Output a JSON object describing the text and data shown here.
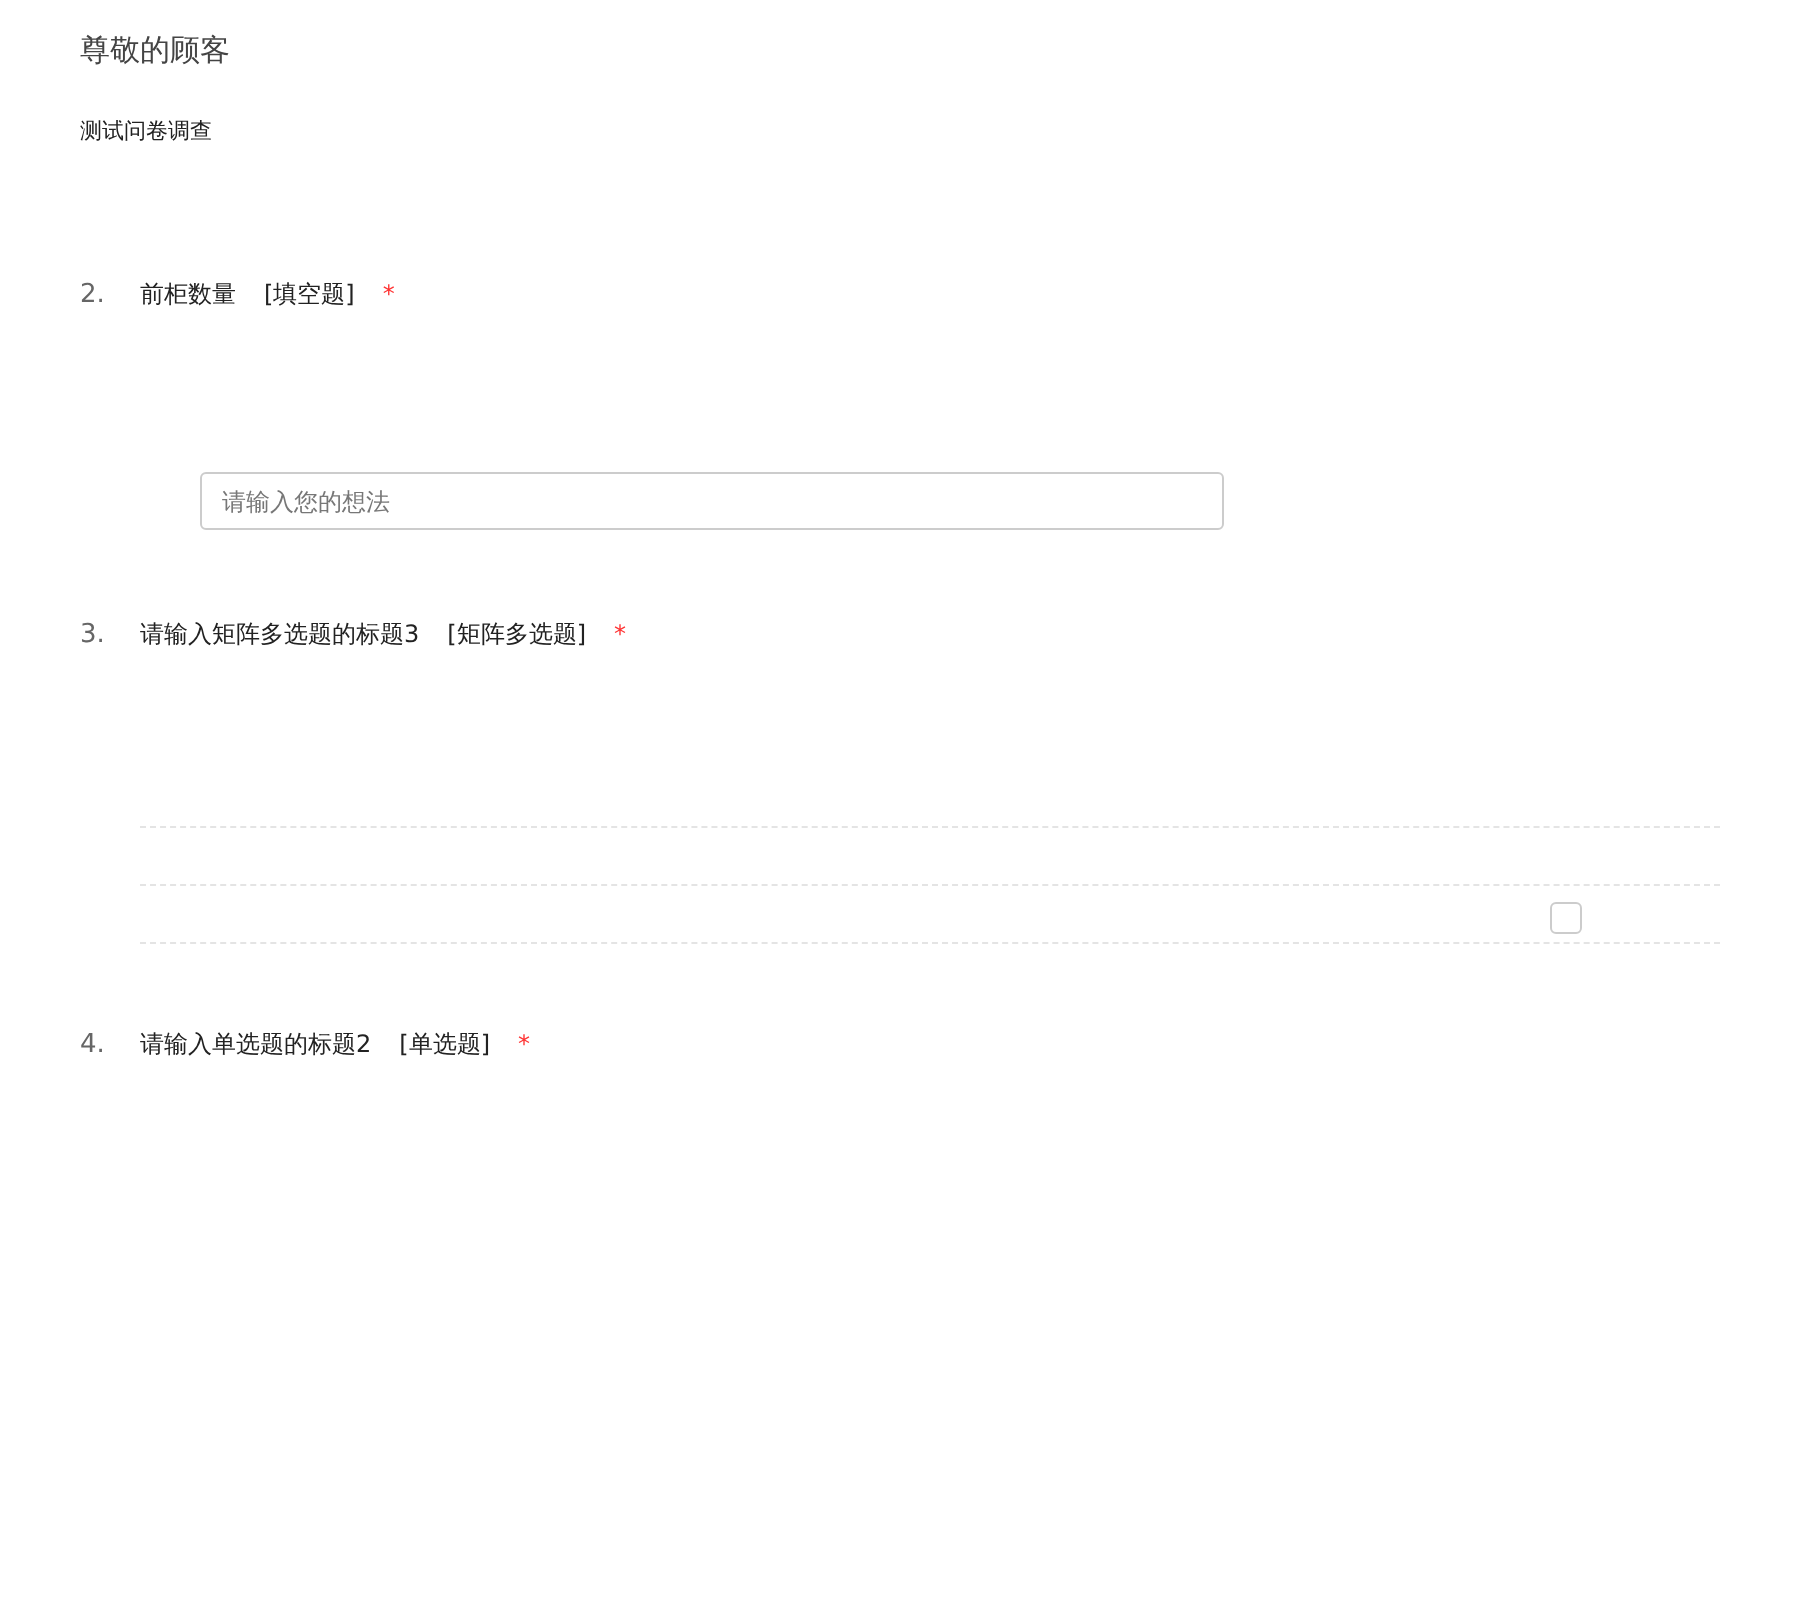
{
  "greeting": "尊敬的顾客",
  "subtitle": "测试问卷调查",
  "questions": [
    {
      "kind": "fill",
      "number": "2.",
      "title": "前柜数量",
      "type_label": "[填空题]",
      "required_mark": "*",
      "placeholder": "请输入您的想法"
    },
    {
      "kind": "matrix",
      "number": "3.",
      "title": "请输入矩阵多选题的标题3",
      "type_label": "[矩阵多选题]",
      "required_mark": "*",
      "rows": [
        {
          "kind": "blank"
        },
        {
          "kind": "checkbox",
          "checked": false
        }
      ]
    },
    {
      "kind": "single",
      "number": "4.",
      "title": "请输入单选题的标题2",
      "type_label": "[单选题]",
      "required_mark": "*"
    }
  ]
}
